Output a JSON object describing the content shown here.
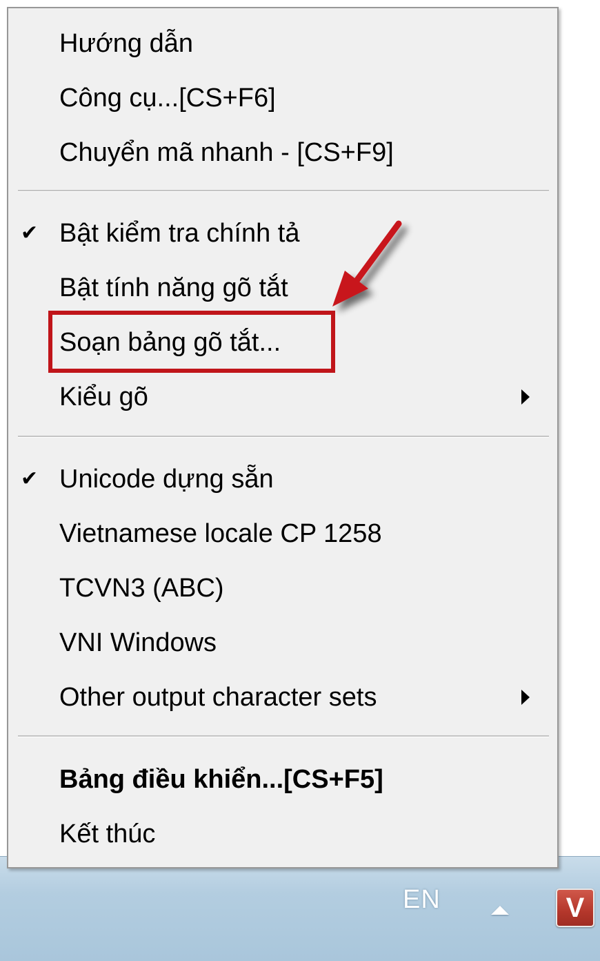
{
  "menu": {
    "items": [
      {
        "label": "Hướng dẫn",
        "checked": false,
        "submenu": false,
        "bold": false
      },
      {
        "label": "Công cụ...[CS+F6]",
        "checked": false,
        "submenu": false,
        "bold": false
      },
      {
        "label": "Chuyển mã nhanh - [CS+F9]",
        "checked": false,
        "submenu": false,
        "bold": false
      },
      {
        "label": "Bật kiểm tra chính tả",
        "checked": true,
        "submenu": false,
        "bold": false
      },
      {
        "label": "Bật tính năng gõ tắt",
        "checked": false,
        "submenu": false,
        "bold": false
      },
      {
        "label": "Soạn bảng gõ tắt...",
        "checked": false,
        "submenu": false,
        "bold": false,
        "highlighted": true
      },
      {
        "label": "Kiểu gõ",
        "checked": false,
        "submenu": true,
        "bold": false
      },
      {
        "label": "Unicode dựng sẵn",
        "checked": true,
        "submenu": false,
        "bold": false
      },
      {
        "label": "Vietnamese locale CP 1258",
        "checked": false,
        "submenu": false,
        "bold": false
      },
      {
        "label": "TCVN3 (ABC)",
        "checked": false,
        "submenu": false,
        "bold": false
      },
      {
        "label": "VNI Windows",
        "checked": false,
        "submenu": false,
        "bold": false
      },
      {
        "label": "Other output character sets",
        "checked": false,
        "submenu": true,
        "bold": false
      },
      {
        "label": "Bảng điều khiển...[CS+F5]",
        "checked": false,
        "submenu": false,
        "bold": true
      },
      {
        "label": "Kết thúc",
        "checked": false,
        "submenu": false,
        "bold": false
      }
    ],
    "check_glyph": "✔",
    "icons": {
      "check": "checkmark-icon",
      "submenu": "submenu-arrow-icon"
    }
  },
  "taskbar": {
    "language": "EN",
    "app_icon_letter": "V",
    "icons": [
      "show-hidden-icons-icon",
      "vietnamese-input-app-icon"
    ]
  },
  "colors": {
    "highlight_box": "#c0151a",
    "menu_background": "#f0f0f0",
    "taskbar": "#b3cde0",
    "app_icon": "#b4372b"
  }
}
